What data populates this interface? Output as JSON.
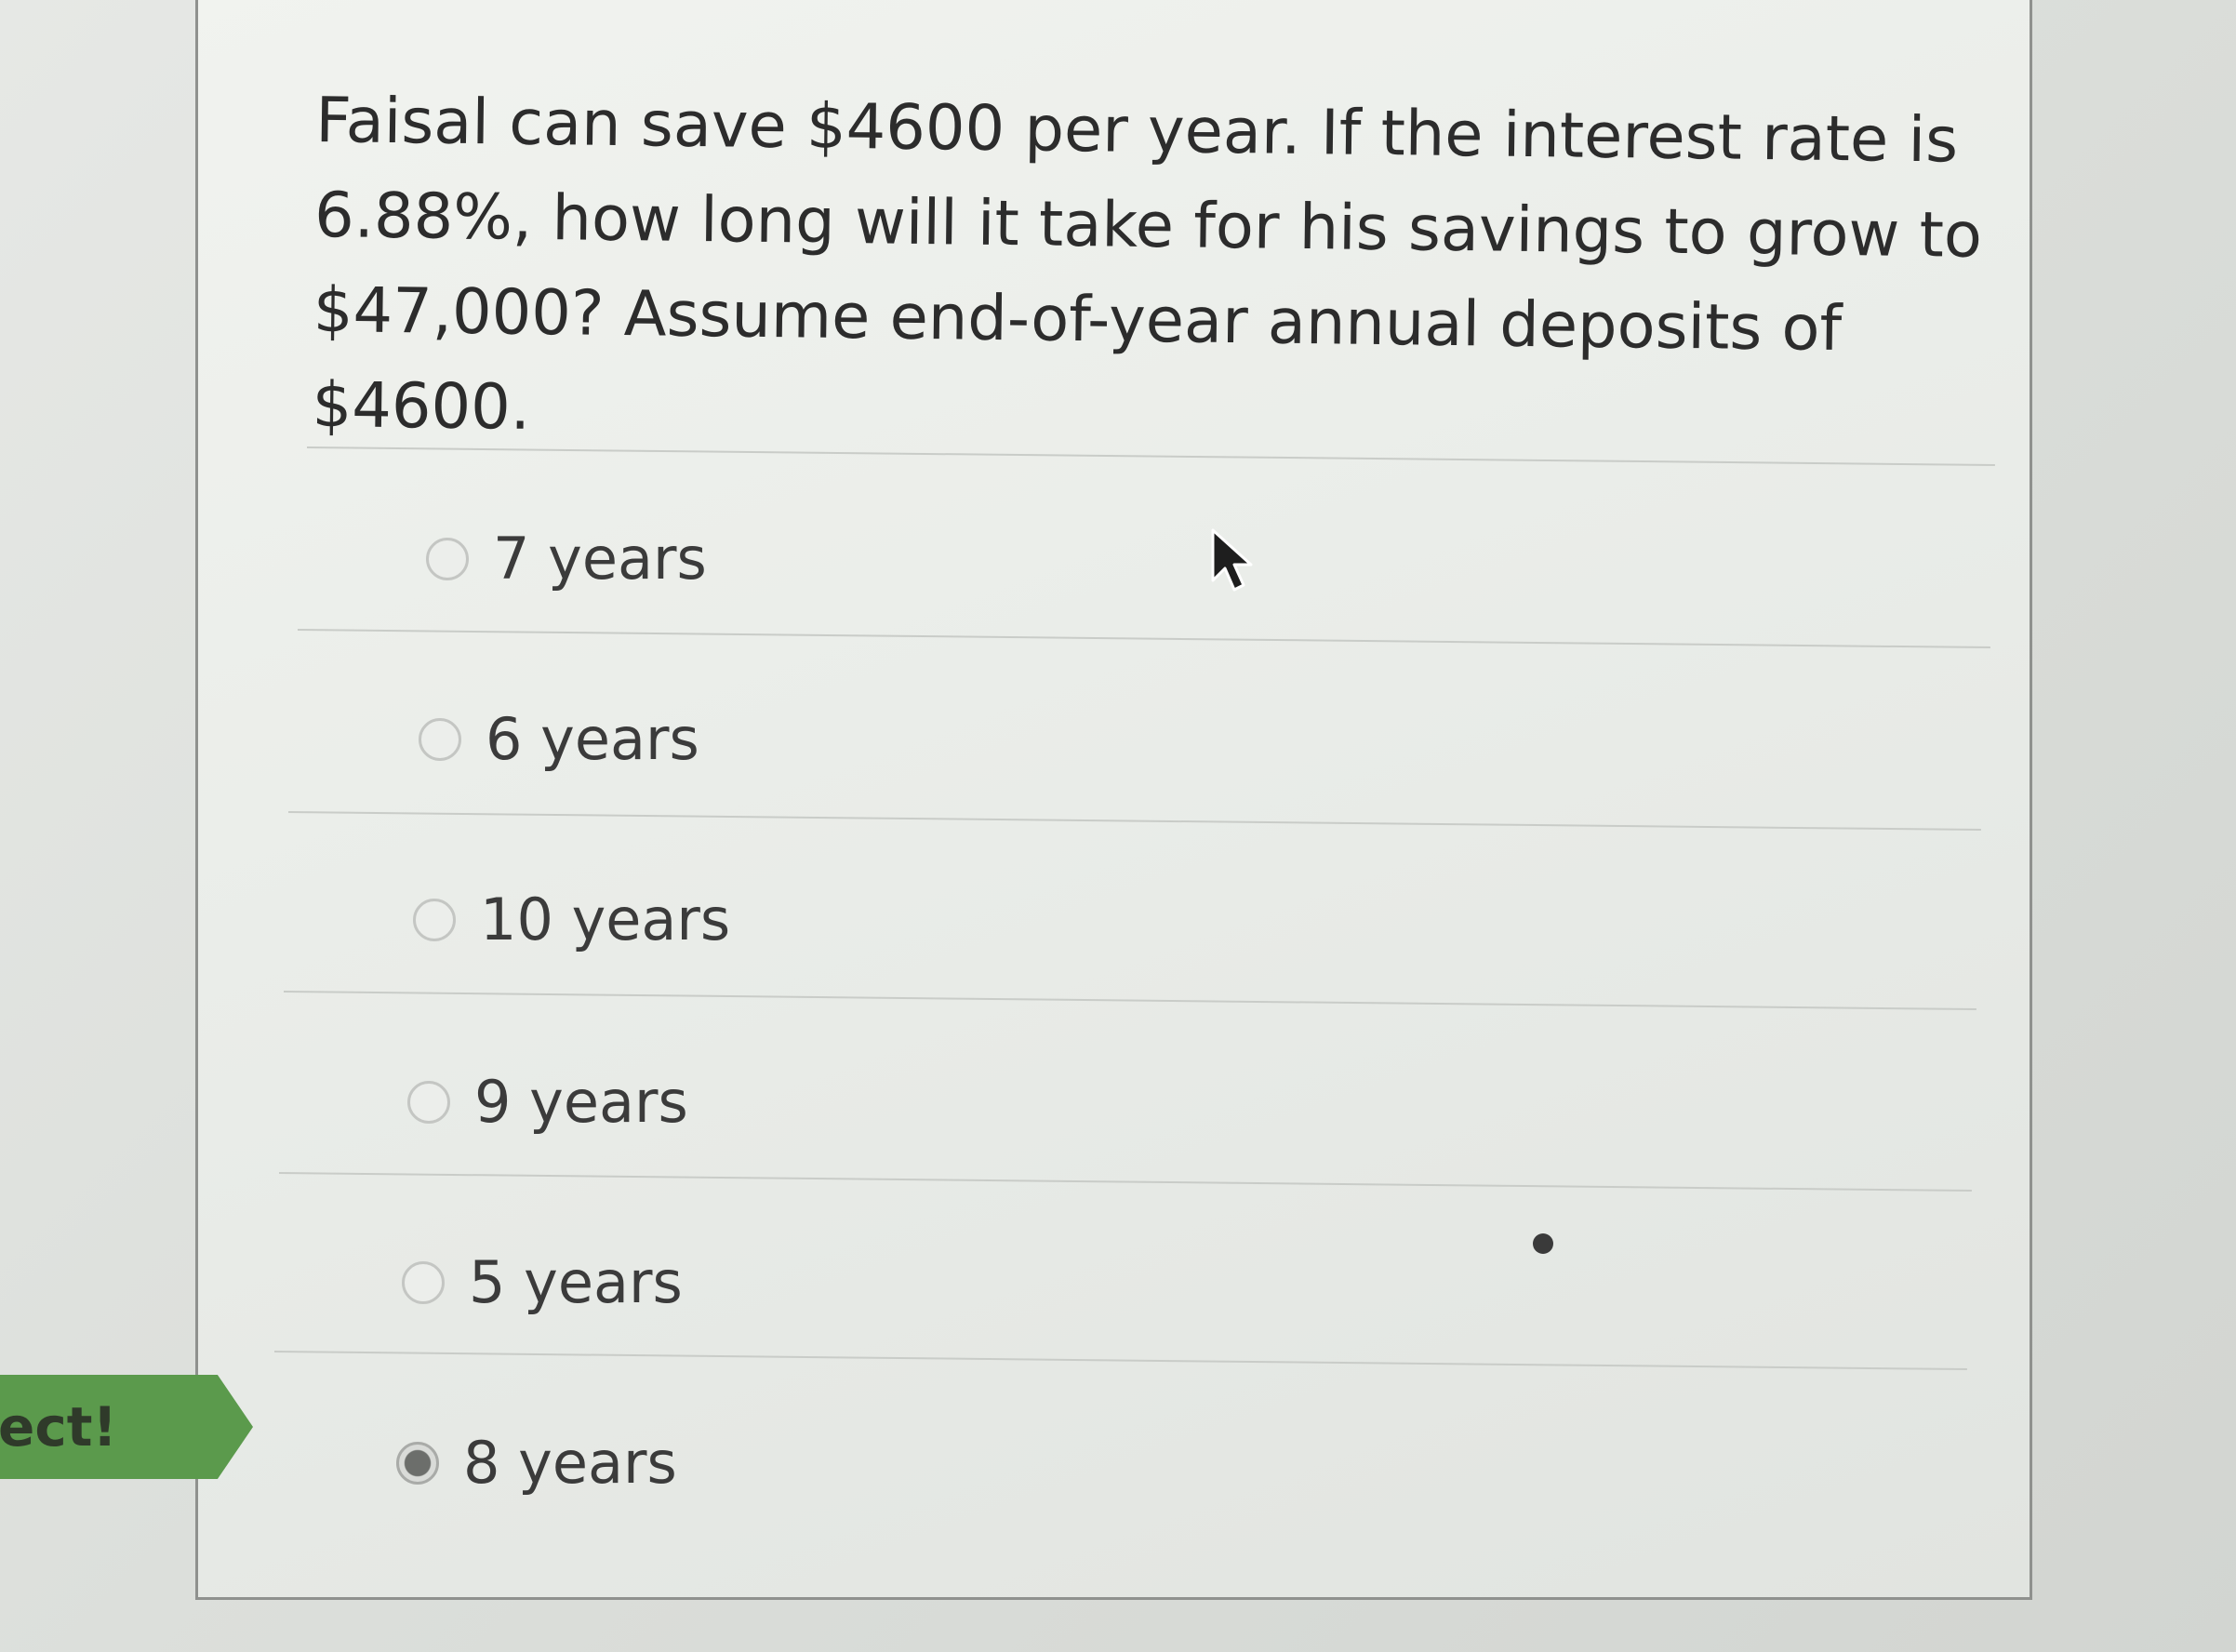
{
  "question": {
    "text": "Faisal can save $4600 per year. If the interest rate is 6.88%, how long will it take for his savings to grow to $47,000? Assume end-of-year annual deposits of $4600."
  },
  "options": [
    {
      "label": "7 years",
      "selected": false
    },
    {
      "label": "6 years",
      "selected": false
    },
    {
      "label": "10 years",
      "selected": false
    },
    {
      "label": "9 years",
      "selected": false
    },
    {
      "label": "5 years",
      "selected": false
    },
    {
      "label": "8 years",
      "selected": true
    }
  ],
  "feedback": {
    "text": "ect!",
    "color": "#5b9a4c"
  },
  "icons": {
    "cursor": "mouse-pointer-arrow"
  }
}
